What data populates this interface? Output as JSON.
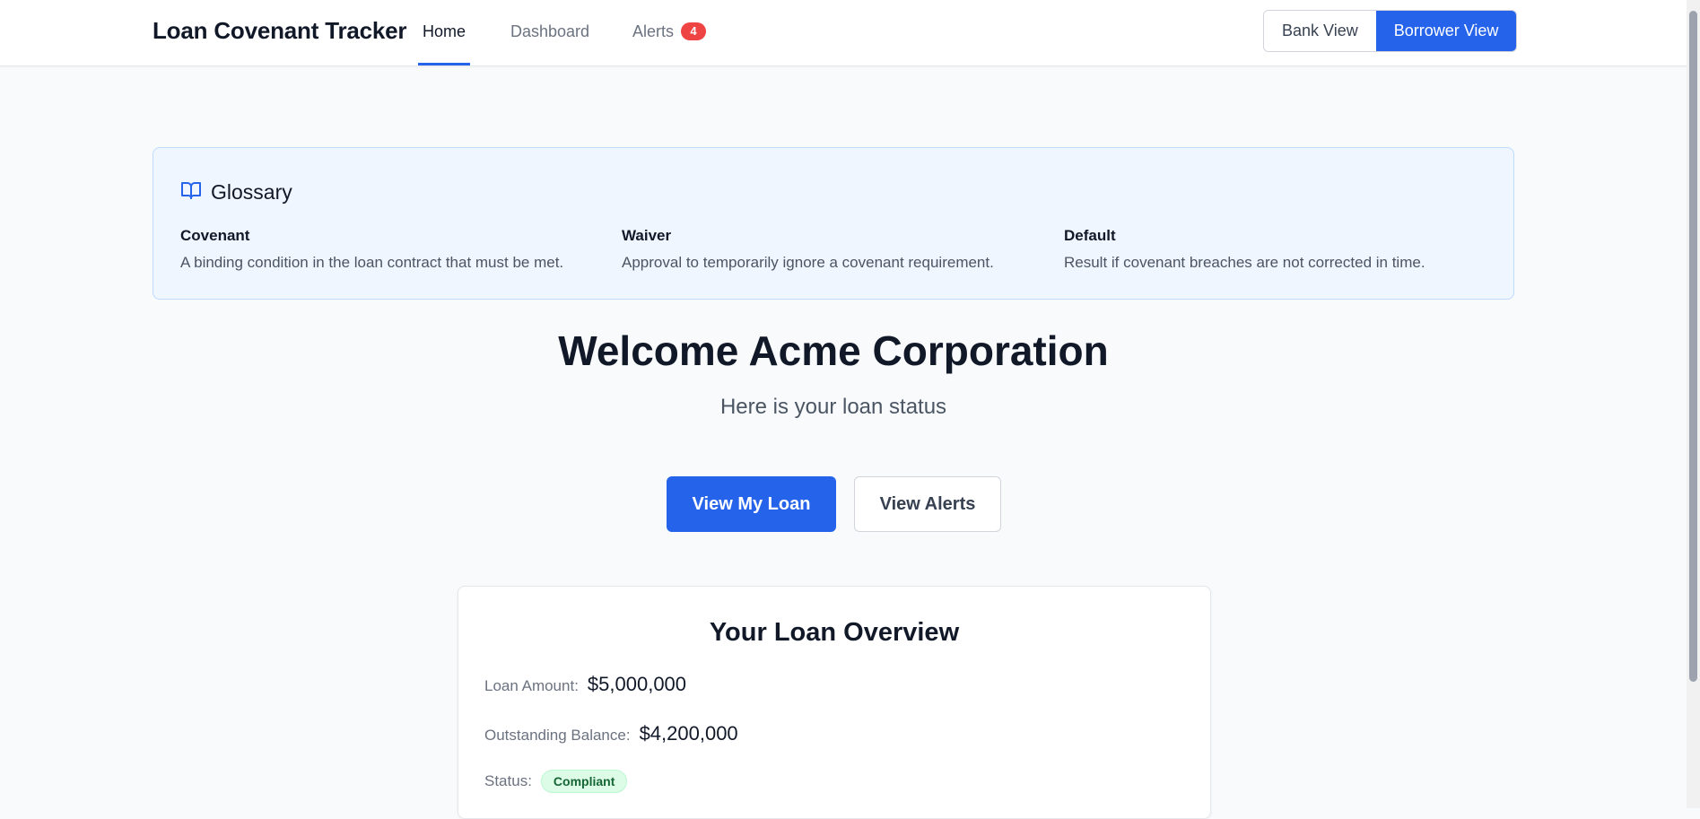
{
  "nav": {
    "brand": "Loan Covenant Tracker",
    "links": [
      {
        "label": "Home"
      },
      {
        "label": "Dashboard"
      },
      {
        "label": "Alerts",
        "badge": "4"
      }
    ],
    "view_toggle": {
      "bank": "Bank View",
      "borrower": "Borrower View",
      "active": "Borrower View"
    }
  },
  "glossary": {
    "title": "Glossary",
    "icon": "book-open-icon",
    "terms": [
      {
        "term": "Covenant",
        "definition": "A binding condition in the loan contract that must be met."
      },
      {
        "term": "Waiver",
        "definition": "Approval to temporarily ignore a covenant requirement."
      },
      {
        "term": "Default",
        "definition": "Result if covenant breaches are not corrected in time."
      }
    ]
  },
  "hero": {
    "title": "Welcome Acme Corporation",
    "subtitle": "Here is your loan status",
    "primary_button": "View My Loan",
    "secondary_button": "View Alerts"
  },
  "overview": {
    "title": "Your Loan Overview",
    "loan_amount_label": "Loan Amount:",
    "loan_amount": "$5,000,000",
    "balance_label": "Outstanding Balance:",
    "balance": "$4,200,000",
    "status_label": "Status:",
    "status": "Compliant"
  },
  "colors": {
    "accent": "#2563eb",
    "badge": "#ef4444",
    "glossary_bg": "#eff6ff",
    "status_bg": "#dcfce7",
    "status_text": "#166534"
  }
}
